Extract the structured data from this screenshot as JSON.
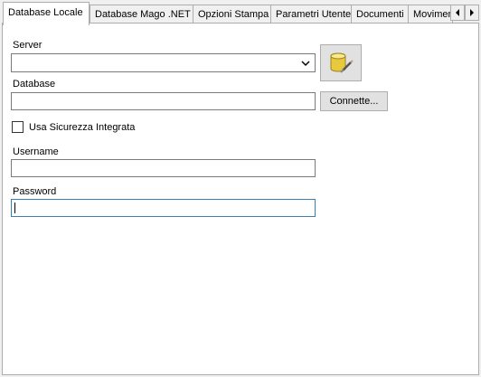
{
  "tabs": [
    {
      "label": "Database Locale",
      "active": true
    },
    {
      "label": "Database Mago .NET",
      "active": false
    },
    {
      "label": "Opzioni Stampa",
      "active": false
    },
    {
      "label": "Parametri Utente",
      "active": false
    },
    {
      "label": "Documenti",
      "active": false
    },
    {
      "label": "Movimenti",
      "active": false
    }
  ],
  "tab_scroll": {
    "left_icon": "chevron-left-icon",
    "right_icon": "chevron-right-icon"
  },
  "form": {
    "server_label": "Server",
    "server_value": "",
    "database_label": "Database",
    "database_value": "",
    "connect_button": "Connette...",
    "db_icon": "database-connect-icon",
    "integrated_security_label": "Usa Sicurezza Integrata",
    "integrated_security_checked": false,
    "username_label": "Username",
    "username_value": "",
    "password_label": "Password",
    "password_value": ""
  }
}
